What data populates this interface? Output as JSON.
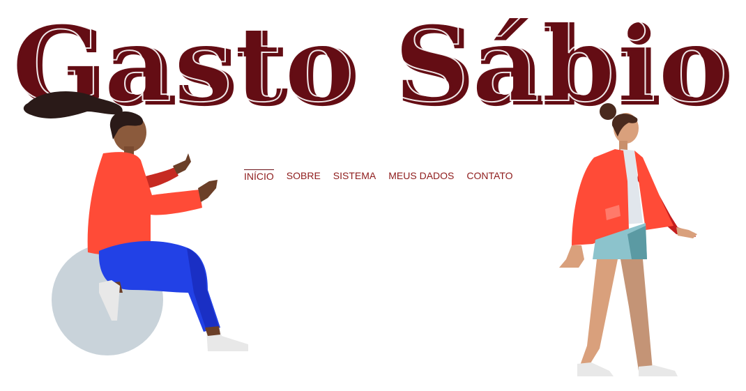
{
  "header": {
    "logo_text": "Gasto Sábio",
    "logo_color": "#640d14"
  },
  "nav": {
    "items": [
      {
        "label": "INÍCIO",
        "active": true
      },
      {
        "label": "SOBRE",
        "active": false
      },
      {
        "label": "SISTEMA",
        "active": false
      },
      {
        "label": "MEUS DADOS",
        "active": false
      },
      {
        "label": "CONTATO",
        "active": false
      }
    ],
    "link_color": "#8e1b1b"
  },
  "illustrations": {
    "left": "woman-sitting-on-exercise-ball",
    "right": "woman-walking"
  }
}
